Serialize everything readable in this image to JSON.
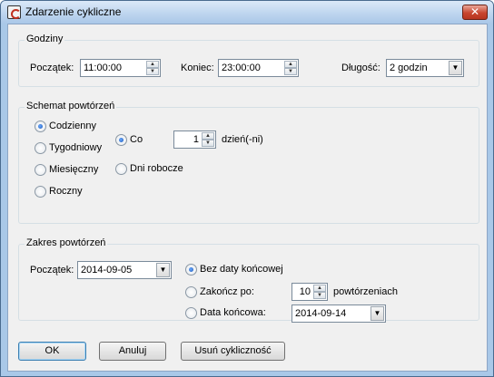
{
  "window": {
    "title": "Zdarzenie cykliczne",
    "close_label": "✕"
  },
  "hours": {
    "group_label": "Godziny",
    "start_label": "Początek:",
    "start_value": "11:00:00",
    "end_label": "Koniec:",
    "end_value": "23:00:00",
    "duration_label": "Długość:",
    "duration_value": "2 godzin"
  },
  "pattern": {
    "group_label": "Schemat powtórzeń",
    "options": [
      "Codzienny",
      "Tygodniowy",
      "Miesięczny",
      "Roczny"
    ],
    "selected": "Codzienny",
    "every_label": "Co",
    "every_value": "1",
    "every_unit": "dzień(-ni)",
    "workdays_label": "Dni robocze"
  },
  "range": {
    "group_label": "Zakres powtórzeń",
    "start_label": "Początek:",
    "start_value": "2014-09-05",
    "no_end_label": "Bez daty końcowej",
    "end_after_label": "Zakończ po:",
    "end_after_value": "10",
    "end_after_unit": "powtórzeniach",
    "end_date_label": "Data końcowa:",
    "end_date_value": "2014-09-14"
  },
  "buttons": {
    "ok": "OK",
    "cancel": "Anuluj",
    "remove": "Usuń cykliczność"
  },
  "colors": {
    "accent": "#1c58b5",
    "frame": "#a9c8e8",
    "close": "#c8452e"
  }
}
